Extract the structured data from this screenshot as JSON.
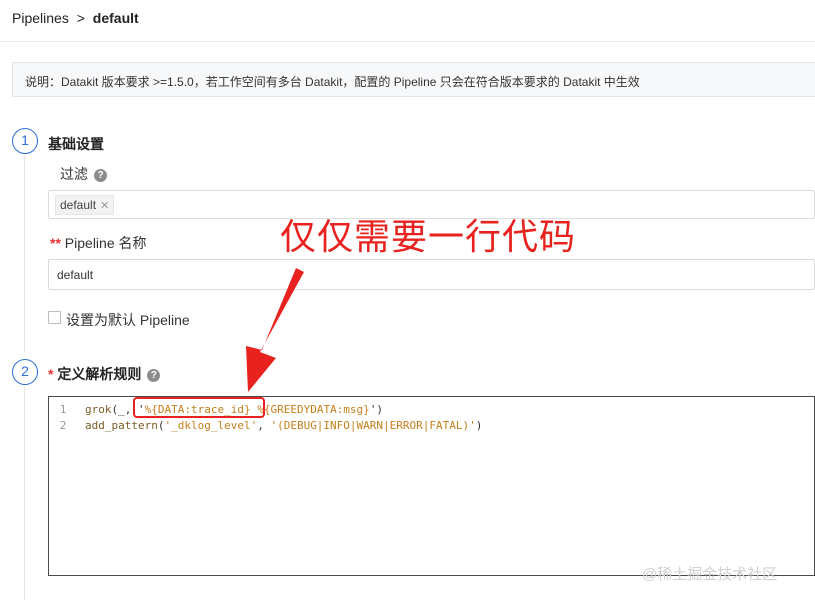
{
  "breadcrumb": {
    "root": "Pipelines",
    "separator": ">",
    "current": "default"
  },
  "notice": "说明：Datakit 版本要求 >=1.5.0，若工作空间有多台 Datakit，配置的 Pipeline 只会在符合版本要求的 Datakit 中生效",
  "step1": {
    "number": "1",
    "title": "基础设置",
    "filter_label": "过滤",
    "filter_tag": "default",
    "name_label": "Pipeline 名称",
    "name_value": "default",
    "default_checkbox_label": "设置为默认 Pipeline"
  },
  "step2": {
    "number": "2",
    "title": "定义解析规则"
  },
  "code": {
    "line1": {
      "num": "1",
      "fn": "grok",
      "open": "(_, '",
      "pat1": "%{DATA:trace_id}",
      "space": " ",
      "pat2": "%{GREEDYDATA:msg}",
      "close": "')"
    },
    "line2": {
      "num": "2",
      "fn": "add_pattern",
      "open": "(",
      "arg1": "'_dklog_level'",
      "comma": ", ",
      "arg2": "'(DEBUG|INFO|WARN|ERROR|FATAL)'",
      "close": ")"
    }
  },
  "annotation_text": "仅仅需要一行代码",
  "watermark": "@稀土掘金技术社区",
  "colors": {
    "accent": "#2f6fd8",
    "annotation": "#e8231f",
    "required": "#e33333"
  }
}
